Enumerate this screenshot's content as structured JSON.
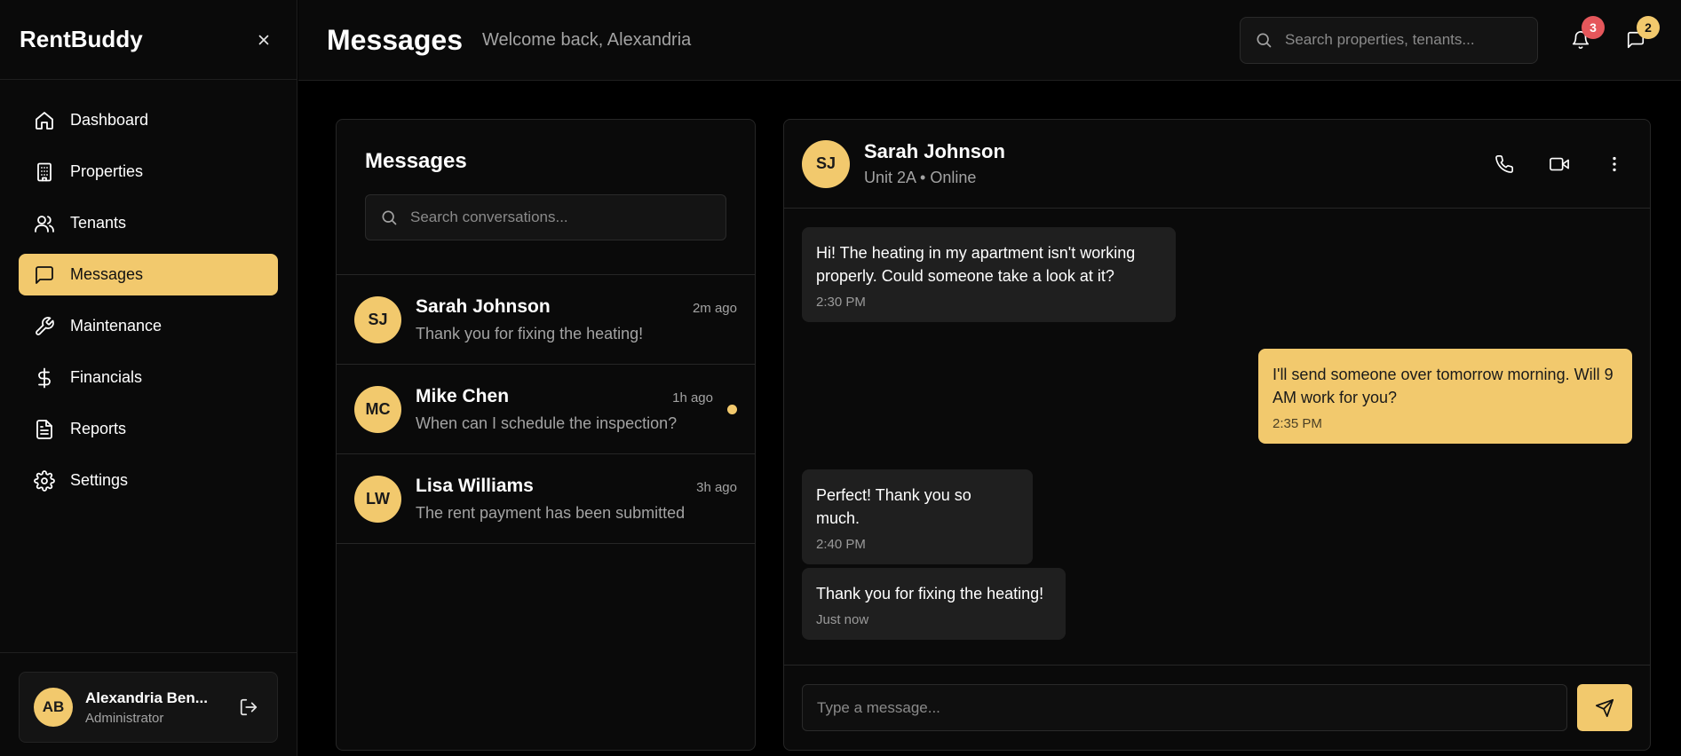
{
  "app": {
    "brand": "RentBuddy",
    "accent_color": "#f2c96d",
    "danger_color": "#e5575b"
  },
  "sidebar": {
    "close_icon": "close-icon",
    "items": [
      {
        "label": "Dashboard",
        "icon": "home-icon",
        "active": false
      },
      {
        "label": "Properties",
        "icon": "building-icon",
        "active": false
      },
      {
        "label": "Tenants",
        "icon": "users-icon",
        "active": false
      },
      {
        "label": "Messages",
        "icon": "message-square-icon",
        "active": true
      },
      {
        "label": "Maintenance",
        "icon": "wrench-icon",
        "active": false
      },
      {
        "label": "Financials",
        "icon": "dollar-icon",
        "active": false
      },
      {
        "label": "Reports",
        "icon": "file-text-icon",
        "active": false
      },
      {
        "label": "Settings",
        "icon": "gear-icon",
        "active": false
      }
    ],
    "user": {
      "initials": "AB",
      "name": "Alexandria Ben...",
      "role": "Administrator",
      "logout_icon": "logout-icon"
    }
  },
  "header": {
    "title": "Messages",
    "welcome": "Welcome back, Alexandria",
    "search_placeholder": "Search properties, tenants...",
    "notifications_count": "3",
    "messages_count": "2"
  },
  "conversations": {
    "title": "Messages",
    "search_placeholder": "Search conversations...",
    "items": [
      {
        "initials": "SJ",
        "name": "Sarah Johnson",
        "time": "2m ago",
        "preview": "Thank you for fixing the heating!",
        "unread": false
      },
      {
        "initials": "MC",
        "name": "Mike Chen",
        "time": "1h ago",
        "preview": "When can I schedule the inspection?",
        "unread": true
      },
      {
        "initials": "LW",
        "name": "Lisa Williams",
        "time": "3h ago",
        "preview": "The rent payment has been submitted",
        "unread": false
      }
    ]
  },
  "chat": {
    "contact": {
      "initials": "SJ",
      "name": "Sarah Johnson",
      "status": "Unit 2A • Online"
    },
    "actions": [
      "phone-icon",
      "video-icon",
      "more-vertical-icon"
    ],
    "messages": [
      {
        "direction": "in",
        "text": "Hi! The heating in my apartment isn't working properly. Could someone take a look at it?",
        "time": "2:30 PM"
      },
      {
        "direction": "out",
        "text": "I'll send someone over tomorrow morning. Will 9 AM work for you?",
        "time": "2:35 PM"
      },
      {
        "direction": "in",
        "text": "Perfect! Thank you so much.",
        "time": "2:40 PM"
      },
      {
        "direction": "in",
        "text": "Thank you for fixing the heating!",
        "time": "Just now"
      }
    ],
    "composer_placeholder": "Type a message..."
  }
}
